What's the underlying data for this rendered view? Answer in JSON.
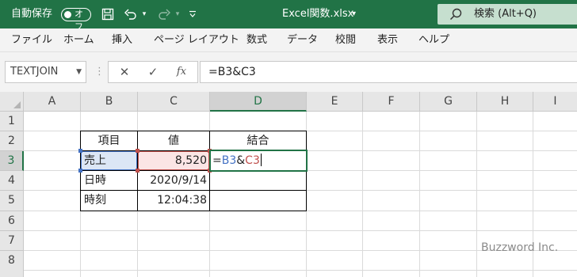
{
  "titlebar": {
    "autosave_label": "自動保存",
    "autosave_state": "オフ",
    "filename": "Excel関数.xlsx",
    "filename_caret": "▾",
    "search_text": "検索 (Alt+Q)",
    "icons": [
      "save-icon",
      "undo-icon",
      "redo-icon",
      "customize-qat-icon",
      "search-icon"
    ]
  },
  "menu": [
    "ファイル",
    "ホーム",
    "挿入",
    "ページ レイアウト",
    "数式",
    "データ",
    "校閲",
    "表示",
    "ヘルプ"
  ],
  "formula_bar": {
    "name_box": "TEXTJOIN",
    "cancel": "✕",
    "enter": "✓",
    "fx": "fx",
    "formula": "=B3&C3"
  },
  "sheet": {
    "columns": [
      "A",
      "B",
      "C",
      "D",
      "E",
      "F",
      "G",
      "H",
      "I"
    ],
    "rows": [
      "1",
      "2",
      "3",
      "4",
      "5",
      "6",
      "7",
      "8"
    ],
    "selected_column": "D",
    "selected_row": "3",
    "table": {
      "headers": [
        "項目",
        "値",
        "結合"
      ],
      "rows": [
        {
          "item": "売上",
          "value": "8,520"
        },
        {
          "item": "日時",
          "value": "2020/9/14"
        },
        {
          "item": "時刻",
          "value": "12:04:38"
        }
      ]
    },
    "editing": {
      "prefix": "=",
      "ref1": "B3",
      "op": "&",
      "ref2": "C3"
    },
    "ref_colors": {
      "ref1": "#4472c4",
      "ref2": "#c0504d"
    }
  },
  "watermark": "Buzzword Inc.",
  "colors": {
    "accent": "#217346",
    "search_bg": "#c6dfcf"
  }
}
